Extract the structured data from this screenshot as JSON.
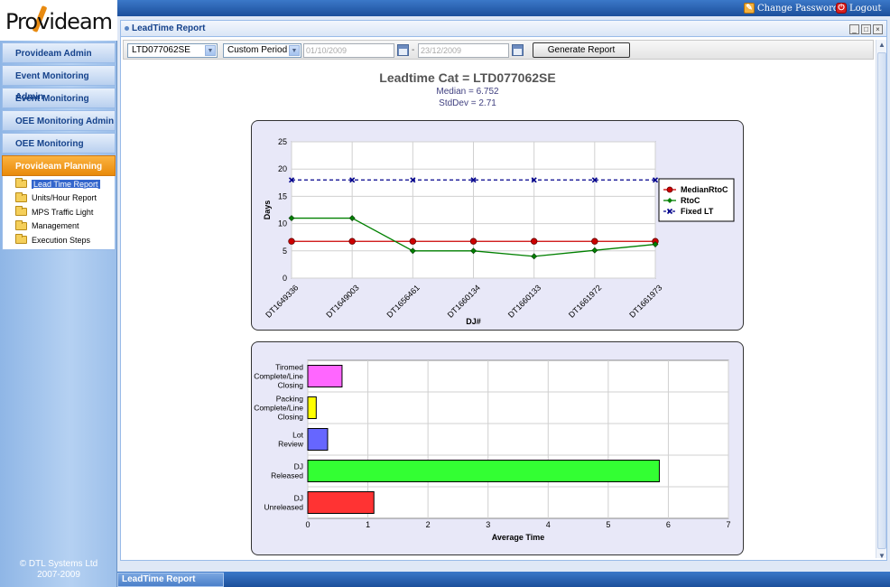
{
  "header": {
    "change_password": "Change Password",
    "logout": "Logout"
  },
  "logo": {
    "text": "Provideam"
  },
  "sidebar": {
    "menu": [
      {
        "label": "Provideam Admin"
      },
      {
        "label": "Event Monitoring Admin"
      },
      {
        "label": "Event Monitoring"
      },
      {
        "label": "OEE Monitoring Admin"
      },
      {
        "label": "OEE Monitoring"
      },
      {
        "label": "Provideam Planning"
      }
    ],
    "submenu": [
      {
        "label": "Lead Time Report"
      },
      {
        "label": "Units/Hour Report"
      },
      {
        "label": "MPS Traffic Light"
      },
      {
        "label": "Management"
      },
      {
        "label": "Execution Steps"
      }
    ],
    "copyright_line1": "© DTL Systems Ltd",
    "copyright_line2": "2007-2009"
  },
  "panel": {
    "title": "LeadTime Report",
    "min": "_",
    "max": "□",
    "close": "×"
  },
  "toolbar": {
    "product_select": "LTD077062SE",
    "period_select": "Custom Period",
    "date_from": "01/10/2009",
    "date_to": "23/12/2009",
    "dash": "-",
    "generate": "Generate Report"
  },
  "report": {
    "title": "Leadtime Cat = LTD077062SE",
    "median": "Median = 6.752",
    "stddev": "StdDev = 2.71"
  },
  "taskbar": {
    "tab": "LeadTime Report"
  },
  "chart_data": [
    {
      "type": "line",
      "xlabel": "DJ#",
      "ylabel": "Days",
      "ylim": [
        0,
        25
      ],
      "yticks": [
        0,
        5,
        10,
        15,
        20,
        25
      ],
      "categories": [
        "DT1649336",
        "DT1649003",
        "DT1656461",
        "DT1660134",
        "DT1660133",
        "DT1661972",
        "DT1661973"
      ],
      "series": [
        {
          "name": "MedianRtoC",
          "color": "#cc0000",
          "marker": "circle",
          "values": [
            6.752,
            6.752,
            6.752,
            6.752,
            6.752,
            6.752,
            6.752
          ]
        },
        {
          "name": "RtoC",
          "color": "#008000",
          "marker": "diamond",
          "values": [
            11,
            11,
            5,
            5,
            4,
            5.1,
            6.2
          ]
        },
        {
          "name": "Fixed LT",
          "color": "#00008b",
          "marker": "x",
          "dashed": true,
          "values": [
            18,
            18,
            18,
            18,
            18,
            18,
            18
          ]
        }
      ],
      "legend": "right",
      "grid": true
    },
    {
      "type": "bar",
      "orientation": "horizontal",
      "xlabel": "Average Time",
      "xlim": [
        0,
        7
      ],
      "xticks": [
        0,
        1,
        2,
        3,
        4,
        5,
        6,
        7
      ],
      "categories": [
        {
          "lines": [
            "Tiromed",
            "Complete/Line",
            "Closing"
          ],
          "value": 0.57,
          "color": "#ff66ff"
        },
        {
          "lines": [
            "Packing",
            "Complete/Line",
            "Closing"
          ],
          "value": 0.14,
          "color": "#ffff00"
        },
        {
          "lines": [
            "Lot",
            "Review"
          ],
          "value": 0.33,
          "color": "#6666ff"
        },
        {
          "lines": [
            "DJ",
            "Released"
          ],
          "value": 5.85,
          "color": "#33ff33"
        },
        {
          "lines": [
            "DJ",
            "Unreleased"
          ],
          "value": 1.1,
          "color": "#ff3333"
        }
      ],
      "grid": true
    }
  ]
}
